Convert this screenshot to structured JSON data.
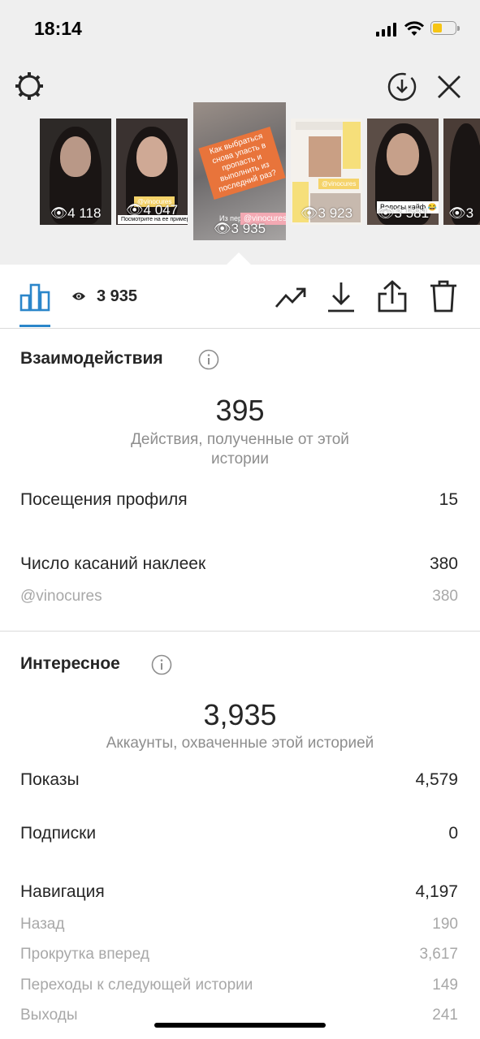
{
  "status_bar": {
    "time": "18:14"
  },
  "icons": {
    "settings": "gear-icon",
    "download_circle": "download-circle-icon",
    "close": "close-icon",
    "chart": "bar-chart-icon",
    "eye": "eye-icon",
    "promote": "trending-up-icon",
    "download": "download-icon",
    "share": "share-icon",
    "delete": "trash-icon",
    "info": "info-icon"
  },
  "colors": {
    "accent": "#2b86ca",
    "highlight_sticker": "#f5d36a",
    "battery": "#f6c515"
  },
  "stories": [
    {
      "views": "4 118"
    },
    {
      "views": "4 047",
      "sticker": "@vinocures",
      "caption": "Посмотрите на ее примере да"
    },
    {
      "views": "3 935",
      "sticker": "@vinocures",
      "caption_top": "Как выбраться снова упасть в пропасть и выполнить из последний раз?",
      "small_text": "Из переп",
      "selected": true
    },
    {
      "views": "3 923",
      "sticker": "@vinocures"
    },
    {
      "views": "3 581",
      "caption": "Волосы кайф 😂"
    },
    {
      "views": "3"
    }
  ],
  "toolbar": {
    "views": "3 935"
  },
  "interactions": {
    "title": "Взаимодействия",
    "total": "395",
    "total_caption": "Действия, полученные от этой истории",
    "rows": [
      {
        "label": "Посещения профиля",
        "value": "15"
      },
      {
        "label": "Число касаний наклеек",
        "value": "380"
      }
    ],
    "sub_rows": [
      {
        "label": "@vinocures",
        "value": "380"
      }
    ]
  },
  "discovery": {
    "title": "Интересное",
    "total": "3,935",
    "total_caption": "Аккаунты, охваченные этой историей",
    "rows": [
      {
        "label": "Показы",
        "value": "4,579"
      },
      {
        "label": "Подписки",
        "value": "0"
      },
      {
        "label": "Навигация",
        "value": "4,197"
      }
    ],
    "nav_rows": [
      {
        "label": "Назад",
        "value": "190"
      },
      {
        "label": "Прокрутка вперед",
        "value": "3,617"
      },
      {
        "label": "Переходы к следующей истории",
        "value": "149"
      },
      {
        "label": "Выходы",
        "value": "241"
      }
    ]
  }
}
